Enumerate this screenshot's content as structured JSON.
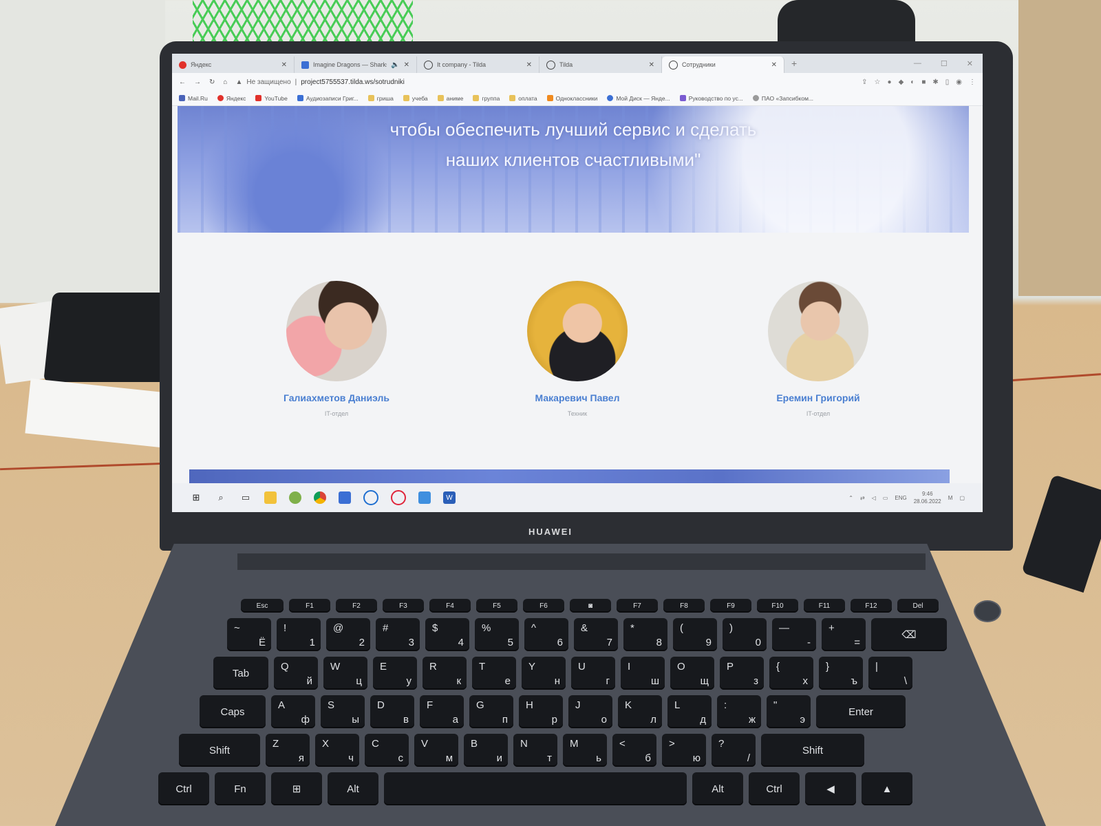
{
  "browser": {
    "tabs": [
      {
        "title": "Яндекс",
        "color": "#e1312b",
        "active": false
      },
      {
        "title": "Imagine Dragons — Sharks",
        "color": "#3b6fd4",
        "active": false
      },
      {
        "title": "It company - Tilda",
        "color": "#444",
        "active": false
      },
      {
        "title": "Tilda",
        "color": "#444",
        "active": false
      },
      {
        "title": "Сотрудники",
        "color": "#444",
        "active": true
      }
    ],
    "new_tab": "+",
    "security": "Не защищено",
    "url": "project5755537.tilda.ws/sotrudniki",
    "bookmarks": [
      {
        "label": "Mail.Ru",
        "color": "#4a63b8"
      },
      {
        "label": "Яндекс",
        "color": "#e1312b"
      },
      {
        "label": "YouTube",
        "color": "#e1312b"
      },
      {
        "label": "Аудиозаписи Григ...",
        "color": "#3b6fd4"
      },
      {
        "label": "гриша",
        "color": "#e8c25a"
      },
      {
        "label": "учеба",
        "color": "#e8c25a"
      },
      {
        "label": "аниме",
        "color": "#e8c25a"
      },
      {
        "label": "группа",
        "color": "#e8c25a"
      },
      {
        "label": "оплата",
        "color": "#e8c25a"
      },
      {
        "label": "Одноклассники",
        "color": "#f08a1f"
      },
      {
        "label": "Мой Диск — Янде...",
        "color": "#3b6fd4"
      },
      {
        "label": "Руководство по ус...",
        "color": "#7a5bd1"
      },
      {
        "label": "ПАО «Запсибком...",
        "color": "#9a9a9a"
      }
    ]
  },
  "hero": {
    "line1": "чтобы обеспечить лучший сервис и сделать",
    "line2": "наших клиентов счастливыми\""
  },
  "people": [
    {
      "name": "Галиахметов Даниэль",
      "role": "IT-отдел"
    },
    {
      "name": "Макаревич Павел",
      "role": "Техник"
    },
    {
      "name": "Еремин Григорий",
      "role": "IT-отдел"
    }
  ],
  "taskbar": {
    "lang": "ENG",
    "time": "9:46",
    "date": "28.06.2022"
  },
  "laptop": {
    "brand": "HUAWEI"
  },
  "keyboard": {
    "fn_row": [
      "Esc",
      "F1",
      "F2",
      "F3",
      "F4",
      "F5",
      "F6",
      "",
      "F7",
      "F8",
      "F9",
      "F10",
      "F11",
      "F12",
      "Del"
    ],
    "row1": [
      {
        "top": "~",
        "sub": "Ё"
      },
      {
        "top": "!",
        "sub": "1"
      },
      {
        "top": "@",
        "sub": "2"
      },
      {
        "top": "#",
        "sub": "3"
      },
      {
        "top": "$",
        "sub": "4"
      },
      {
        "top": "%",
        "sub": "5"
      },
      {
        "top": "^",
        "sub": "6"
      },
      {
        "top": "&",
        "sub": "7"
      },
      {
        "top": "*",
        "sub": "8"
      },
      {
        "top": "(",
        "sub": "9"
      },
      {
        "top": ")",
        "sub": "0"
      },
      {
        "top": "—",
        "sub": "-"
      },
      {
        "top": "+",
        "sub": "="
      }
    ],
    "row2": [
      {
        "top": "Q",
        "sub": "й"
      },
      {
        "top": "W",
        "sub": "ц"
      },
      {
        "top": "E",
        "sub": "у"
      },
      {
        "top": "R",
        "sub": "к"
      },
      {
        "top": "T",
        "sub": "е"
      },
      {
        "top": "Y",
        "sub": "н"
      },
      {
        "top": "U",
        "sub": "г"
      },
      {
        "top": "I",
        "sub": "ш"
      },
      {
        "top": "O",
        "sub": "щ"
      },
      {
        "top": "P",
        "sub": "з"
      },
      {
        "top": "{",
        "sub": "х"
      },
      {
        "top": "}",
        "sub": "ъ"
      },
      {
        "top": "|",
        "sub": "\\"
      }
    ],
    "row3": [
      {
        "top": "A",
        "sub": "ф"
      },
      {
        "top": "S",
        "sub": "ы"
      },
      {
        "top": "D",
        "sub": "в"
      },
      {
        "top": "F",
        "sub": "а"
      },
      {
        "top": "G",
        "sub": "п"
      },
      {
        "top": "H",
        "sub": "р"
      },
      {
        "top": "J",
        "sub": "о"
      },
      {
        "top": "K",
        "sub": "л"
      },
      {
        "top": "L",
        "sub": "д"
      },
      {
        "top": ":",
        "sub": "ж"
      },
      {
        "top": "\"",
        "sub": "э"
      }
    ],
    "row4": [
      {
        "top": "Z",
        "sub": "я"
      },
      {
        "top": "X",
        "sub": "ч"
      },
      {
        "top": "C",
        "sub": "с"
      },
      {
        "top": "V",
        "sub": "м"
      },
      {
        "top": "B",
        "sub": "и"
      },
      {
        "top": "N",
        "sub": "т"
      },
      {
        "top": "M",
        "sub": "ь"
      },
      {
        "top": "<",
        "sub": "б"
      },
      {
        "top": ">",
        "sub": "ю"
      },
      {
        "top": "?",
        "sub": "/"
      }
    ],
    "tab": "Tab",
    "caps": "Caps",
    "enter": "Enter",
    "shift_l": "Shift",
    "shift_r": "Shift",
    "ctrl_l": "Ctrl",
    "fn": "Fn",
    "alt_l": "Alt",
    "alt_r": "Alt",
    "ctrl_r": "Ctrl"
  }
}
